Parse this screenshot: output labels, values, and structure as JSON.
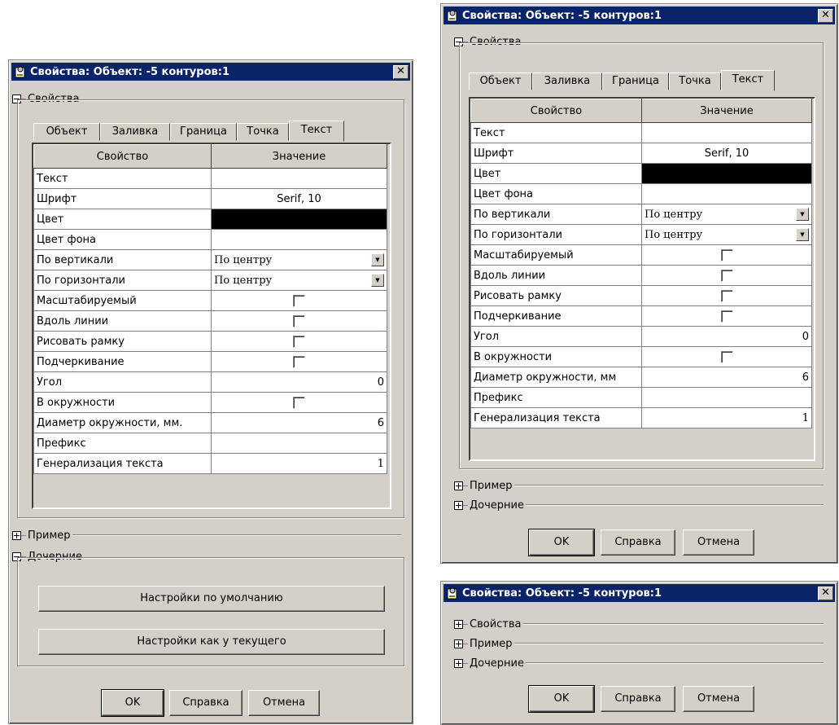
{
  "window_title": "Свойства: Объект: -5 контуров:1",
  "close_glyph": "✕",
  "expander_collapsed": "+",
  "expander_expanded": "−",
  "sections": {
    "properties": "Свойства",
    "example": "Пример",
    "children": "Дочерние"
  },
  "tabs": [
    "Объект",
    "Заливка",
    "Граница",
    "Точка",
    "Текст"
  ],
  "active_tab": "Текст",
  "grid": {
    "columns": [
      "Свойство",
      "Значение"
    ],
    "rows": {
      "text": "Текст",
      "font": "Шрифт",
      "font_value": "Serif, 10",
      "color": "Цвет",
      "bg_color": "Цвет фона",
      "vertical": "По вертикали",
      "vertical_value": "По центру",
      "horizontal": "По горизонтали",
      "horizontal_value": "По центру",
      "scalable": "Масштабируемый",
      "along_line": "Вдоль линии",
      "draw_frame": "Рисовать рамку",
      "underline": "Подчеркивание",
      "angle": "Угол",
      "angle_value": "0",
      "in_circle": "В окружности",
      "circle_diameter_left": "Диаметр окружности, мм.",
      "circle_diameter_right": "Диаметр окружности, мм",
      "circle_diameter_value": "6",
      "prefix": "Префикс",
      "generalization": "Генерализация текста",
      "generalization_value": "1"
    }
  },
  "children_buttons": {
    "defaults": "Настройки по умолчанию",
    "as_current": "Настройки как у текущего"
  },
  "footer": {
    "ok": "OK",
    "help": "Справка",
    "cancel": "Отмена"
  },
  "colors": {
    "title_bar": "#0a246a",
    "face": "#d4d0c8",
    "color_value": "#000000"
  }
}
